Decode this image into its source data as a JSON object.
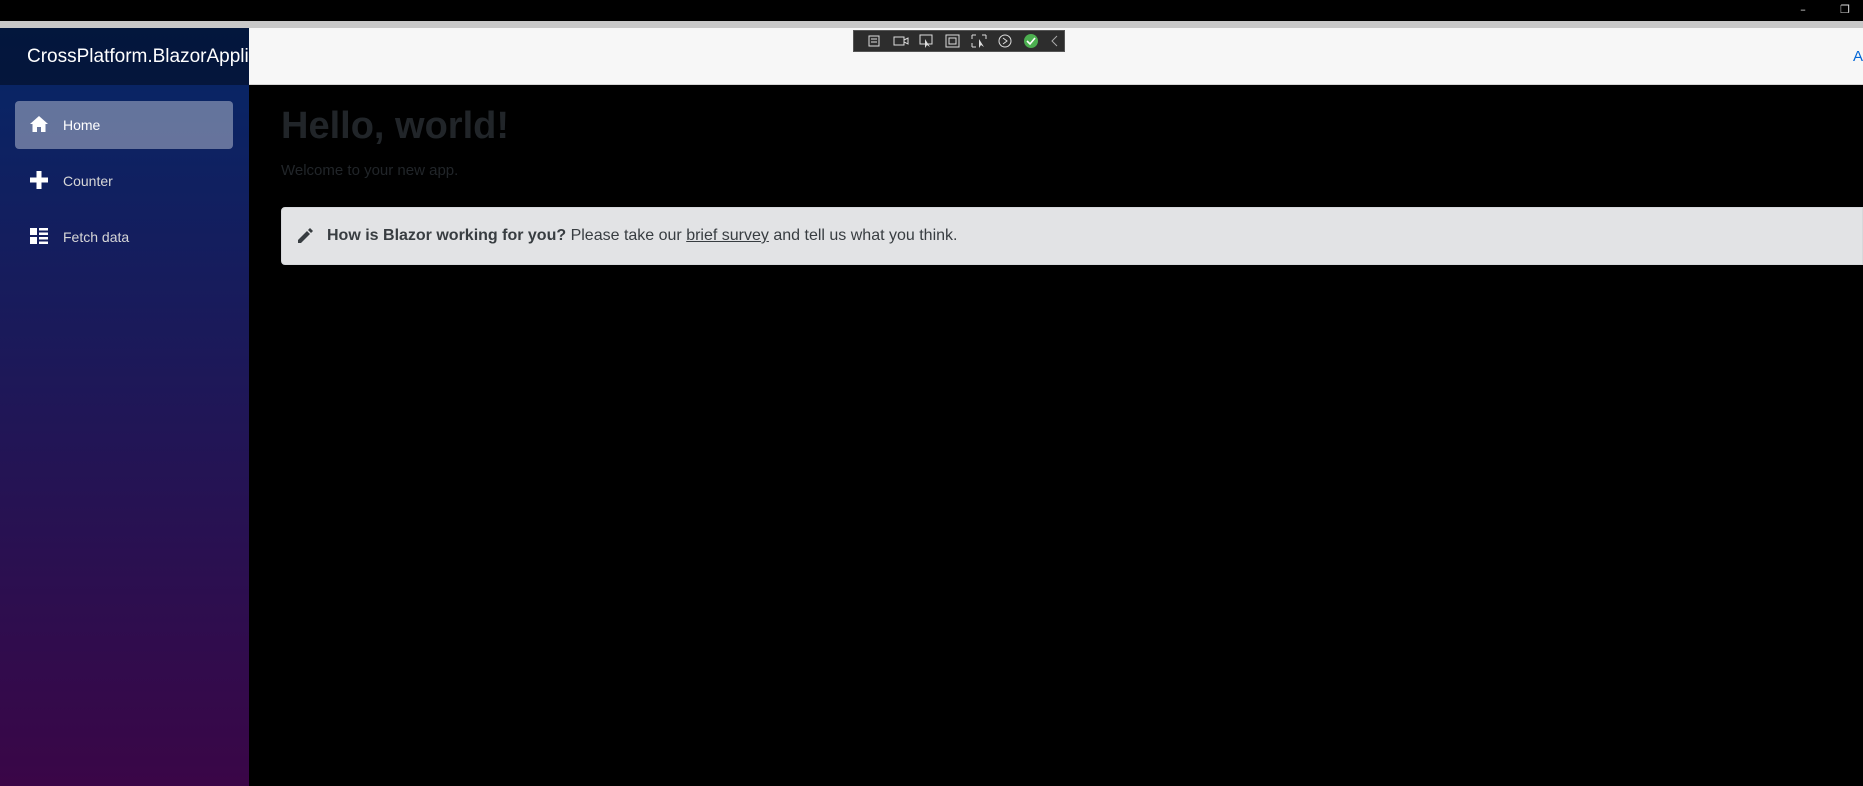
{
  "window": {
    "minimize_glyph": "–",
    "restore_glyph": "❐"
  },
  "sidebar": {
    "brand": "CrossPlatform.BlazorApplicat",
    "items": [
      {
        "label": "Home",
        "icon": "home-icon",
        "active": true
      },
      {
        "label": "Counter",
        "icon": "plus-icon",
        "active": false
      },
      {
        "label": "Fetch data",
        "icon": "list-icon",
        "active": false
      }
    ]
  },
  "topbar": {
    "about_label": "A"
  },
  "main": {
    "title": "Hello, world!",
    "subtitle": "Welcome to your new app.",
    "survey": {
      "bold": "How is Blazor working for you?",
      "before_link": " Please take our ",
      "link": "brief survey",
      "after_link": " and tell us what you think."
    }
  },
  "colors": {
    "sidebar_top": "#052767",
    "sidebar_bottom": "#3a0647",
    "alert_bg": "#e2e3e5",
    "link": "#0366d6"
  }
}
